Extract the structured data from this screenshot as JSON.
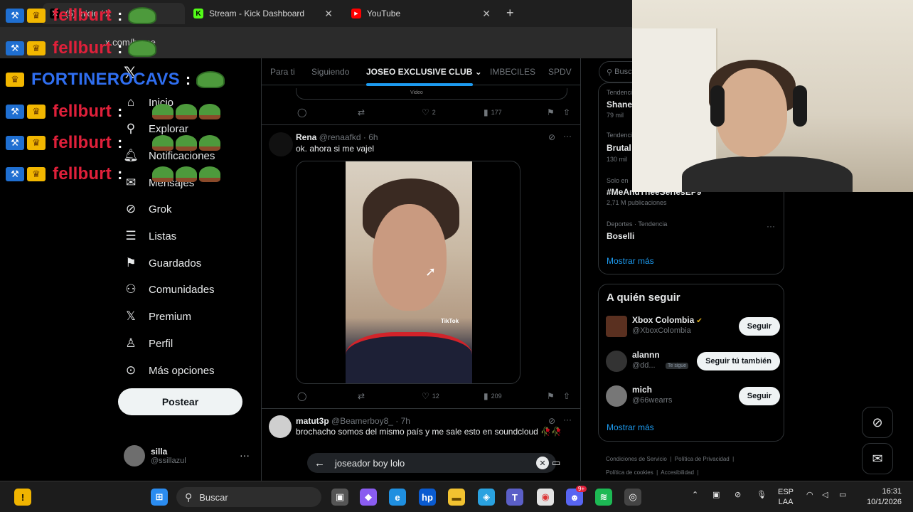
{
  "browser": {
    "tabs": [
      {
        "label": "(5) Inicio / X",
        "icon": "x-icon"
      },
      {
        "label": "Stream - Kick Dashboard",
        "icon": "kick-icon"
      },
      {
        "label": "YouTube",
        "icon": "youtube-icon"
      }
    ],
    "url": "x.com/home"
  },
  "nav": {
    "items": [
      {
        "label": "Inicio",
        "icon": "home-icon"
      },
      {
        "label": "Explorar",
        "icon": "search-icon"
      },
      {
        "label": "Notificaciones",
        "icon": "bell-icon"
      },
      {
        "label": "Mensajes",
        "icon": "mail-icon"
      },
      {
        "label": "Grok",
        "icon": "grok-icon"
      },
      {
        "label": "Listas",
        "icon": "list-icon"
      },
      {
        "label": "Guardados",
        "icon": "bookmark-icon"
      },
      {
        "label": "Comunidades",
        "icon": "people-icon"
      },
      {
        "label": "Premium",
        "icon": "x-icon"
      },
      {
        "label": "Perfil",
        "icon": "person-icon"
      },
      {
        "label": "Más opciones",
        "icon": "more-circle-icon"
      }
    ],
    "post_label": "Postear",
    "profile": {
      "name": "silla",
      "handle": "@ssillazul"
    }
  },
  "timeline": {
    "tabs": [
      "Para ti",
      "Siguiendo",
      "JOSEO EXCLUSIVE CLUB",
      "IMBECILES",
      "SPDV"
    ],
    "active_tab": "JOSEO EXCLUSIVE CLUB",
    "prev_tweet": {
      "media_label": "Video",
      "likes": "2",
      "views": "177"
    },
    "tweet1": {
      "name": "Rena",
      "handle": "@renaafkd",
      "time": "· 6h",
      "text": "ok. ahora si me vajel",
      "likes": "12",
      "views": "209",
      "video_watermark": "TikTok"
    },
    "tweet2": {
      "name": "matut3p",
      "handle": "@Beamerboy8_",
      "time": "· 7h",
      "text": "brochacho somos del mismo país y me sale esto en soundcloud 🥀🥀"
    }
  },
  "search": {
    "query": "joseador boy lolo"
  },
  "trends": {
    "search_placeholder": "Busc",
    "items": [
      {
        "category": "Tendencia",
        "name": "Shane",
        "count": "79 mil"
      },
      {
        "category": "Tendencia",
        "name": "Brutal",
        "count": "130 mil"
      },
      {
        "category": "Solo en",
        "name": "#MeAndTheeSeriesEP9",
        "count": "2,71 M publicaciones"
      },
      {
        "category": "Deportes · Tendencia",
        "name": "Boselli",
        "count": ""
      }
    ],
    "show_more": "Mostrar más"
  },
  "who_to_follow": {
    "title": "A quién seguir",
    "accounts": [
      {
        "name": "Xbox Colombia",
        "handle": "@XboxColombia",
        "button": "Seguir"
      },
      {
        "name": "alannn",
        "handle": "@dd...",
        "badge": "Te sigue",
        "button": "Seguir tú también"
      },
      {
        "name": "mich",
        "handle": "@66wearrs",
        "button": "Seguir"
      }
    ],
    "show_more": "Mostrar más"
  },
  "footer_links": [
    "Condiciones de Servicio",
    "Política de Privacidad",
    "Política de cookies",
    "Accesibilidad"
  ],
  "overlay_chat": [
    {
      "name": "fellburt",
      "color": "red"
    },
    {
      "name": "fellburt",
      "color": "red"
    },
    {
      "name": "FORTINEROCAVS",
      "color": "blue"
    },
    {
      "name": "fellburt",
      "color": "red"
    },
    {
      "name": "fellburt",
      "color": "red"
    },
    {
      "name": "fellburt",
      "color": "red"
    }
  ],
  "taskbar": {
    "search_label": "Buscar",
    "lang": "ESP",
    "lang2": "LAA",
    "time": "16:31",
    "date": "10/1/2026",
    "discord_badge": "9+"
  },
  "colors": {
    "accent": "#1d9bf0",
    "border": "#2f3336",
    "chat_red": "#e0203a",
    "chat_blue": "#2f6ef0"
  }
}
